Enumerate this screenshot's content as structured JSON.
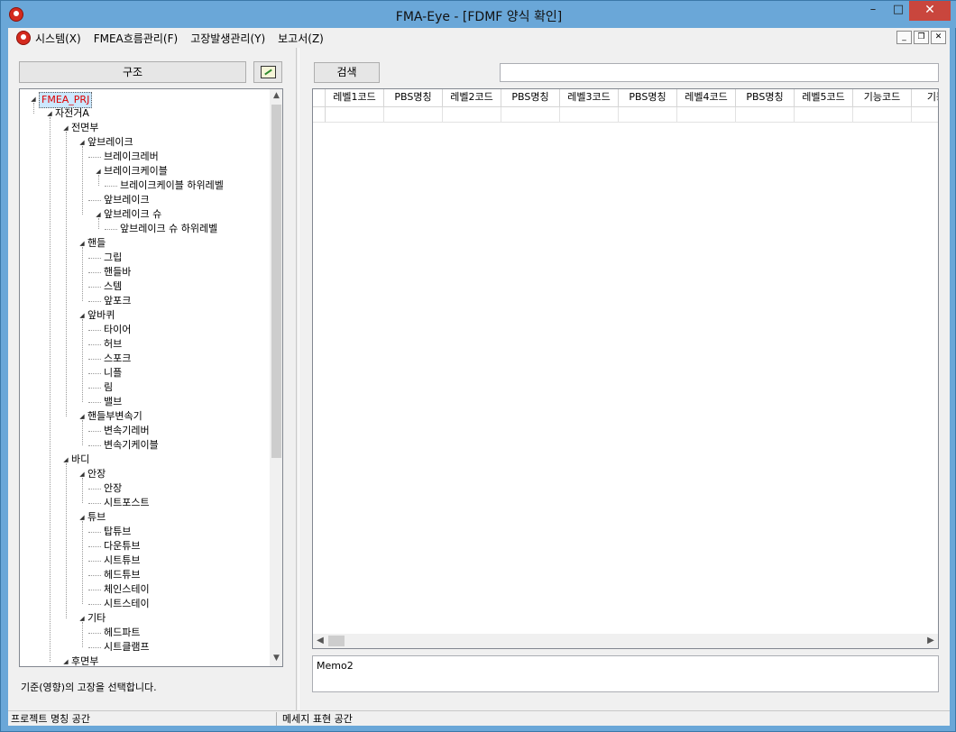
{
  "window": {
    "title": "FMA-Eye - [FDMF 양식 확인]"
  },
  "window_controls": {
    "minimize": "–",
    "maximize": "□",
    "close": "✕"
  },
  "menu": {
    "items": [
      "시스템(X)",
      "FMEA흐름관리(F)",
      "고장발생관리(Y)",
      "보고서(Z)"
    ]
  },
  "mdi_controls": {
    "minimize": "_",
    "restore": "❐",
    "close": "✕"
  },
  "left_panel": {
    "structure_button": "구조",
    "status_text": "기준(영향)의 고장을 선택합니다."
  },
  "tree": {
    "nodes": [
      {
        "label": "FMEA_PRJ",
        "level": 0,
        "expanded": true,
        "selected": true
      },
      {
        "label": "자전거A",
        "level": 1,
        "expanded": true
      },
      {
        "label": "전면부",
        "level": 2,
        "expanded": true
      },
      {
        "label": "앞브레이크",
        "level": 3,
        "expanded": true
      },
      {
        "label": "브레이크레버",
        "level": 4
      },
      {
        "label": "브레이크케이블",
        "level": 4,
        "expanded": true
      },
      {
        "label": "브레이크케이블 하위레벨",
        "level": 5
      },
      {
        "label": "앞브레이크",
        "level": 4
      },
      {
        "label": "앞브레이크 슈",
        "level": 4,
        "expanded": true
      },
      {
        "label": "앞브레이크 슈 하위레벨",
        "level": 5
      },
      {
        "label": "핸들",
        "level": 3,
        "expanded": true
      },
      {
        "label": "그립",
        "level": 4
      },
      {
        "label": "핸들바",
        "level": 4
      },
      {
        "label": "스템",
        "level": 4
      },
      {
        "label": "앞포크",
        "level": 4
      },
      {
        "label": "앞바퀴",
        "level": 3,
        "expanded": true
      },
      {
        "label": "타이어",
        "level": 4
      },
      {
        "label": "허브",
        "level": 4
      },
      {
        "label": "스포크",
        "level": 4
      },
      {
        "label": "니플",
        "level": 4
      },
      {
        "label": "림",
        "level": 4
      },
      {
        "label": "밸브",
        "level": 4
      },
      {
        "label": "핸들부변속기",
        "level": 3,
        "expanded": true
      },
      {
        "label": "변속기레버",
        "level": 4
      },
      {
        "label": "변속기케이블",
        "level": 4
      },
      {
        "label": "바디",
        "level": 2,
        "expanded": true
      },
      {
        "label": "안장",
        "level": 3,
        "expanded": true
      },
      {
        "label": "안장",
        "level": 4
      },
      {
        "label": "시트포스트",
        "level": 4
      },
      {
        "label": "튜브",
        "level": 3,
        "expanded": true
      },
      {
        "label": "탑튜브",
        "level": 4
      },
      {
        "label": "다운튜브",
        "level": 4
      },
      {
        "label": "시트튜브",
        "level": 4
      },
      {
        "label": "헤드튜브",
        "level": 4
      },
      {
        "label": "체인스테이",
        "level": 4
      },
      {
        "label": "시트스테이",
        "level": 4
      },
      {
        "label": "기타",
        "level": 3,
        "expanded": true
      },
      {
        "label": "헤드파트",
        "level": 4
      },
      {
        "label": "시트클램프",
        "level": 4
      },
      {
        "label": "후면부",
        "level": 2,
        "expanded": true
      }
    ]
  },
  "right_panel": {
    "search_button": "검색",
    "search_value": "",
    "grid_columns": [
      "레벨1코드",
      "PBS명칭",
      "레벨2코드",
      "PBS명칭",
      "레벨3코드",
      "PBS명칭",
      "레벨4코드",
      "PBS명칭",
      "레벨5코드",
      "기능코드",
      "기능명"
    ],
    "memo_text": "Memo2"
  },
  "statusbar": {
    "left": "프로젝트 명칭 공간",
    "right": "메세지 표현 공간"
  }
}
